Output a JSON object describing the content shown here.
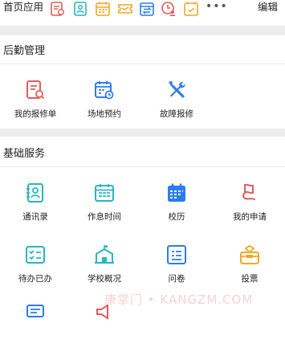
{
  "topbar": {
    "title": "首页应用",
    "edit": "编辑",
    "more": "•••"
  },
  "sections": [
    {
      "title": "后勤管理"
    },
    {
      "title": "基础服务"
    }
  ],
  "logistics": [
    {
      "label": "我的报修单",
      "icon": "repair-order-icon"
    },
    {
      "label": "场地预约",
      "icon": "calendar-clock-icon"
    },
    {
      "label": "故障报修",
      "icon": "tools-icon"
    }
  ],
  "basic": [
    {
      "label": "通讯录",
      "icon": "contacts-icon"
    },
    {
      "label": "作息时间",
      "icon": "schedule-icon"
    },
    {
      "label": "校历",
      "icon": "school-calendar-icon"
    },
    {
      "label": "我的申请",
      "icon": "flag-icon"
    },
    {
      "label": "待办已办",
      "icon": "todo-list-icon"
    },
    {
      "label": "学校概况",
      "icon": "school-building-icon"
    },
    {
      "label": "问卷",
      "icon": "survey-icon"
    },
    {
      "label": "投票",
      "icon": "vote-box-icon"
    }
  ],
  "watermark": "康掌门 • KANGZM.COM",
  "colors": {
    "teal": "#27b6c0",
    "blue": "#2d7cf0",
    "red": "#e65a5a",
    "orange": "#f5a623",
    "separator": "#ededed"
  }
}
